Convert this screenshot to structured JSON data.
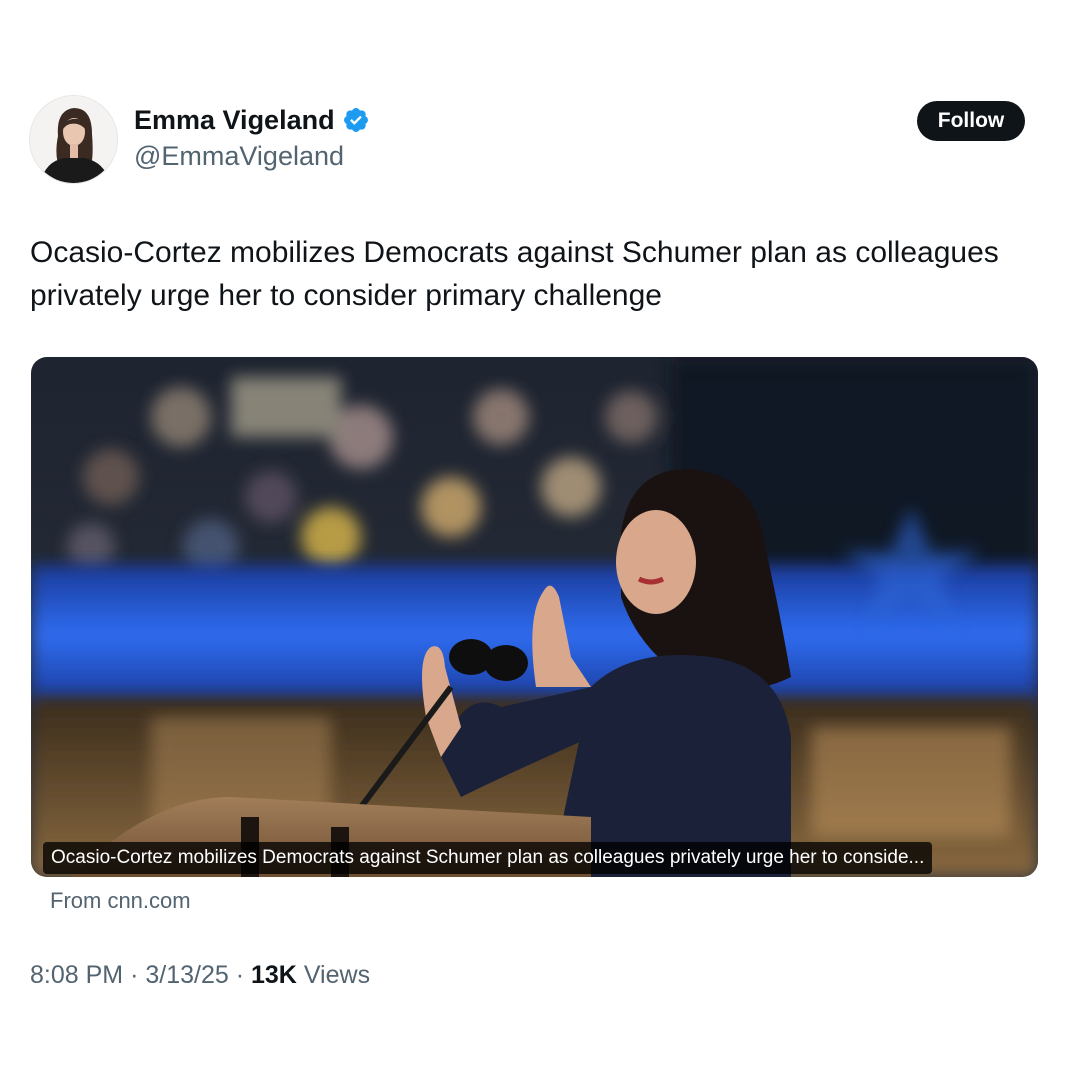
{
  "author": {
    "display_name": "Emma Vigeland",
    "handle": "@EmmaVigeland",
    "verified_color": "#1d9bf0"
  },
  "follow_button": {
    "label": "Follow"
  },
  "tweet": {
    "text": "Ocasio-Cortez mobilizes Democrats against Schumer plan as colleagues privately urge her to consider primary challenge"
  },
  "link_card": {
    "caption": "Ocasio-Cortez mobilizes Democrats against Schumer plan as colleagues privately urge her to conside...",
    "source": "From cnn.com"
  },
  "meta": {
    "time": "8:08 PM",
    "separator": "·",
    "date": "3/13/25",
    "views_count": "13K",
    "views_label": "Views"
  },
  "colors": {
    "text_primary": "#0f1419",
    "text_secondary": "#536471",
    "button_bg": "#0f1419",
    "accent": "#1d9bf0"
  }
}
